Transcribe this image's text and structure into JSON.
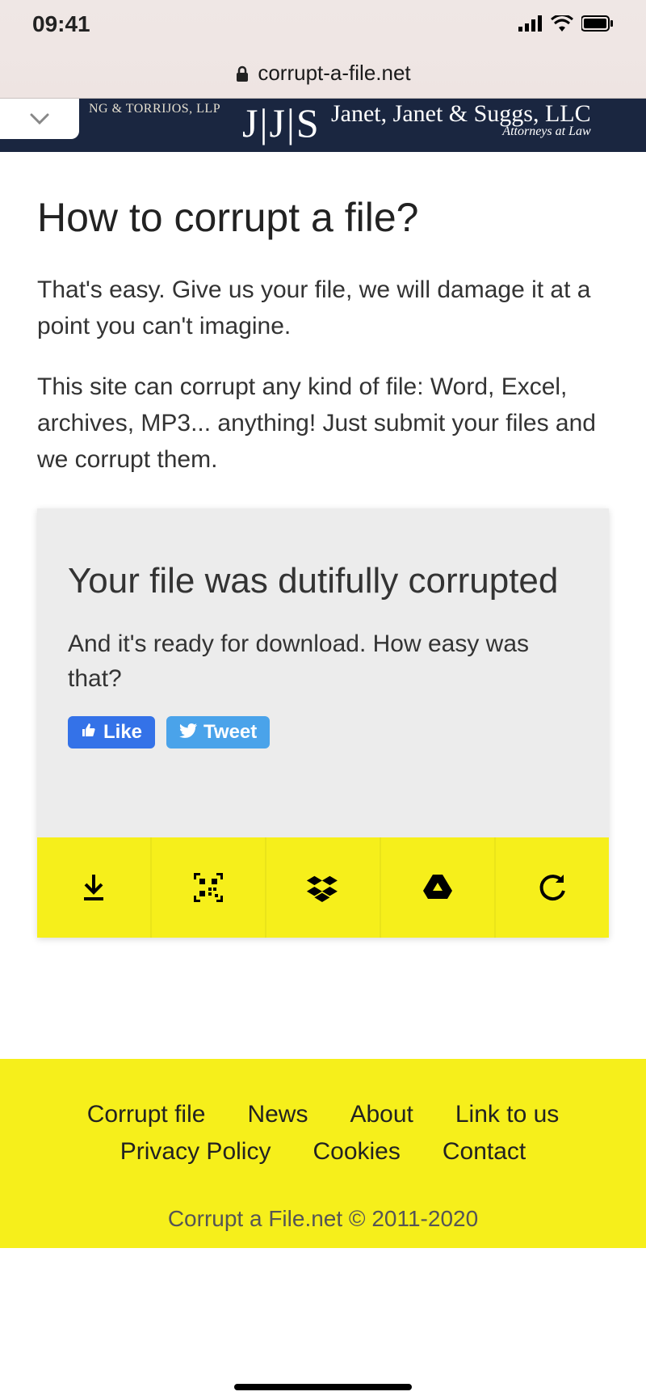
{
  "status": {
    "time": "09:41"
  },
  "browser": {
    "domain": "corrupt-a-file.net"
  },
  "ad": {
    "left_line1": "NG & TORRIJOS, LLP",
    "jjs": "J|J|S",
    "right_main": "Janet, Janet & Suggs, LLC",
    "right_sub": "Attorneys at Law"
  },
  "content": {
    "heading": "How to corrupt a file?",
    "para1": "That's easy. Give us your file, we will damage it at a point you can't imagine.",
    "para2": "This site can corrupt any kind of file: Word, Excel, archives, MP3... anything! Just submit your files and we corrupt them."
  },
  "card": {
    "heading": "Your file was dutifully corrupted",
    "subtext": "And it's ready for download. How easy was that?",
    "like_label": "Like",
    "tweet_label": "Tweet"
  },
  "footer": {
    "links": [
      "Corrupt file",
      "News",
      "About",
      "Link to us",
      "Privacy Policy",
      "Cookies",
      "Contact"
    ],
    "copyright": "Corrupt a File.net © 2011-2020"
  }
}
